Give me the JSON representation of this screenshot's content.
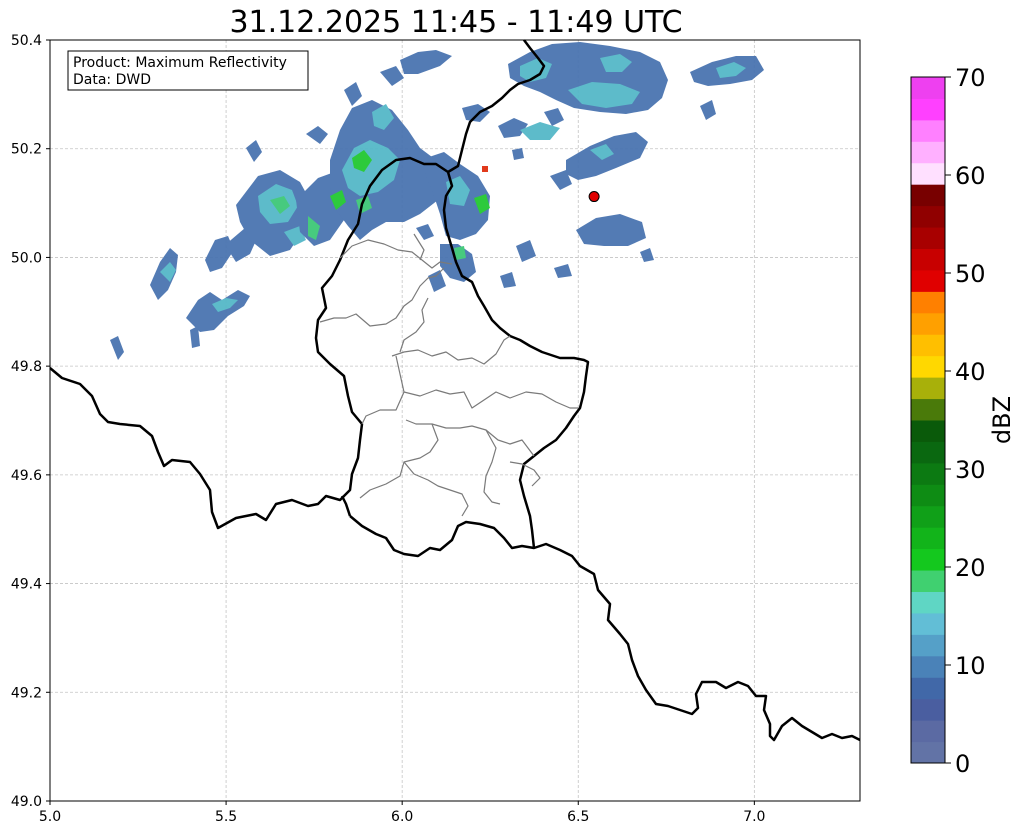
{
  "title": "31.12.2025 11:45 - 11:49 UTC",
  "info_box": {
    "line1": "Product: Maximum Reflectivity",
    "line2": "Data: DWD"
  },
  "map": {
    "xlim": [
      5.0,
      7.3
    ],
    "ylim": [
      49.0,
      50.4
    ],
    "x_ticks": [
      "5.0",
      "5.5",
      "6.0",
      "6.5",
      "7.0"
    ],
    "x_tick_values": [
      5.0,
      5.5,
      6.0,
      6.5,
      7.0
    ],
    "y_ticks": [
      "49.0",
      "49.2",
      "49.4",
      "49.6",
      "49.8",
      "50.0",
      "50.2",
      "50.4"
    ],
    "y_tick_values": [
      49.0,
      49.2,
      49.4,
      49.6,
      49.8,
      50.0,
      50.2,
      50.4
    ],
    "grid": true,
    "marker": {
      "lon": 6.545,
      "lat": 50.112,
      "color": "#e00000"
    }
  },
  "colorbar": {
    "label": "dBZ",
    "range": [
      0,
      70
    ],
    "tick_labels": [
      "0",
      "10",
      "20",
      "30",
      "40",
      "50",
      "60",
      "70"
    ],
    "tick_values": [
      0,
      10,
      20,
      30,
      40,
      50,
      60,
      70
    ],
    "colors": [
      "#6273a6",
      "#5b6aa3",
      "#4a5ea0",
      "#4168a8",
      "#4a82b8",
      "#55a0c8",
      "#62bed6",
      "#5fd6c4",
      "#40d070",
      "#14c81e",
      "#12b41a",
      "#10a018",
      "#0e8c14",
      "#0c7a12",
      "#0a6810",
      "#0a5a0a",
      "#4a7a0a",
      "#a8b00a",
      "#ffd800",
      "#ffbf00",
      "#ffa000",
      "#ff8000",
      "#e00000",
      "#c80000",
      "#a80000",
      "#900000",
      "#780000",
      "#ffe0ff",
      "#ffb0ff",
      "#ff80ff",
      "#ff40ff",
      "#ee40f0"
    ]
  }
}
